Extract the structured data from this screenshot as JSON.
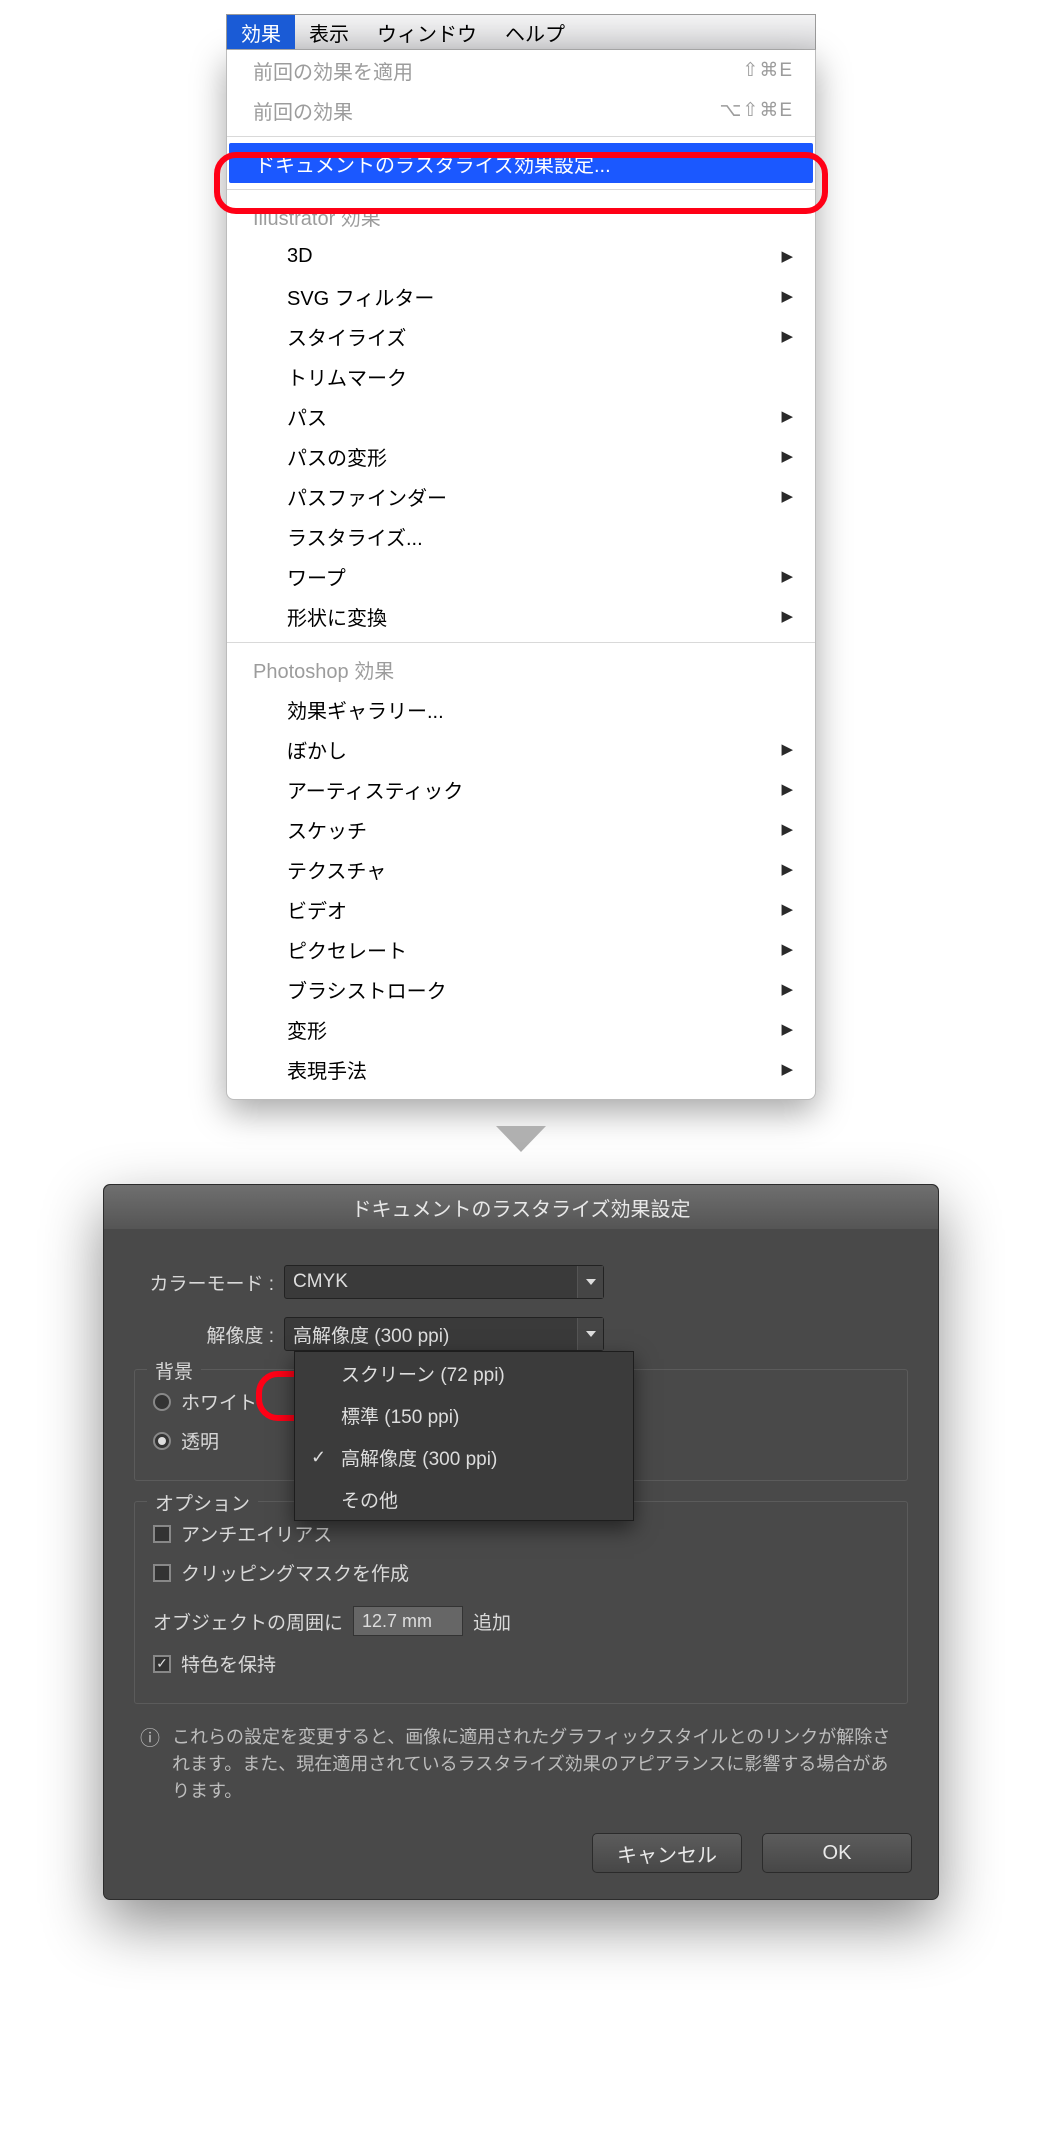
{
  "menubar": {
    "items": [
      "効果",
      "表示",
      "ウィンドウ",
      "ヘルプ"
    ],
    "selected": "効果"
  },
  "menu": {
    "top": [
      {
        "label": "前回の効果を適用",
        "shortcut": "⇧⌘E",
        "disabled": true
      },
      {
        "label": "前回の効果",
        "shortcut": "⌥⇧⌘E",
        "disabled": true
      }
    ],
    "highlight": "ドキュメントのラスタライズ効果設定...",
    "section1": "Illustrator 効果",
    "illustrator": [
      {
        "label": "3D",
        "arrow": true
      },
      {
        "label": "SVG フィルター",
        "arrow": true
      },
      {
        "label": "スタイライズ",
        "arrow": true
      },
      {
        "label": "トリムマーク",
        "arrow": false
      },
      {
        "label": "パス",
        "arrow": true
      },
      {
        "label": "パスの変形",
        "arrow": true
      },
      {
        "label": "パスファインダー",
        "arrow": true
      },
      {
        "label": "ラスタライズ...",
        "arrow": false
      },
      {
        "label": "ワープ",
        "arrow": true
      },
      {
        "label": "形状に変換",
        "arrow": true
      }
    ],
    "section2": "Photoshop 効果",
    "photoshop": [
      {
        "label": "効果ギャラリー...",
        "arrow": false
      },
      {
        "label": "ぼかし",
        "arrow": true
      },
      {
        "label": "アーティスティック",
        "arrow": true
      },
      {
        "label": "スケッチ",
        "arrow": true
      },
      {
        "label": "テクスチャ",
        "arrow": true
      },
      {
        "label": "ビデオ",
        "arrow": true
      },
      {
        "label": "ピクセレート",
        "arrow": true
      },
      {
        "label": "ブラシストローク",
        "arrow": true
      },
      {
        "label": "変形",
        "arrow": true
      },
      {
        "label": "表現手法",
        "arrow": true
      }
    ]
  },
  "dialog": {
    "title": "ドキュメントのラスタライズ効果設定",
    "color_label": "カラーモード :",
    "color_value": "CMYK",
    "res_label": "解像度 :",
    "res_value": "高解像度 (300 ppi)",
    "res_options": [
      "スクリーン (72 ppi)",
      "標準 (150 ppi)",
      "高解像度 (300 ppi)",
      "その他"
    ],
    "res_selected": "高解像度 (300 ppi)",
    "bg_label": "背景",
    "bg_white": "ホワイト",
    "bg_trans": "透明",
    "opt_label": "オプション",
    "opt_aa": "アンチエイリアス",
    "opt_clip": "クリッピングマスクを作成",
    "opt_margin_pre": "オブジェクトの周囲に",
    "opt_margin_val": "12.7 mm",
    "opt_margin_post": "追加",
    "opt_spot": "特色を保持",
    "info": "これらの設定を変更すると、画像に適用されたグラフィックスタイルとのリンクが解除されます。また、現在適用されているラスタライズ効果のアピアランスに影響する場合があります。",
    "cancel": "キャンセル",
    "ok": "OK"
  }
}
